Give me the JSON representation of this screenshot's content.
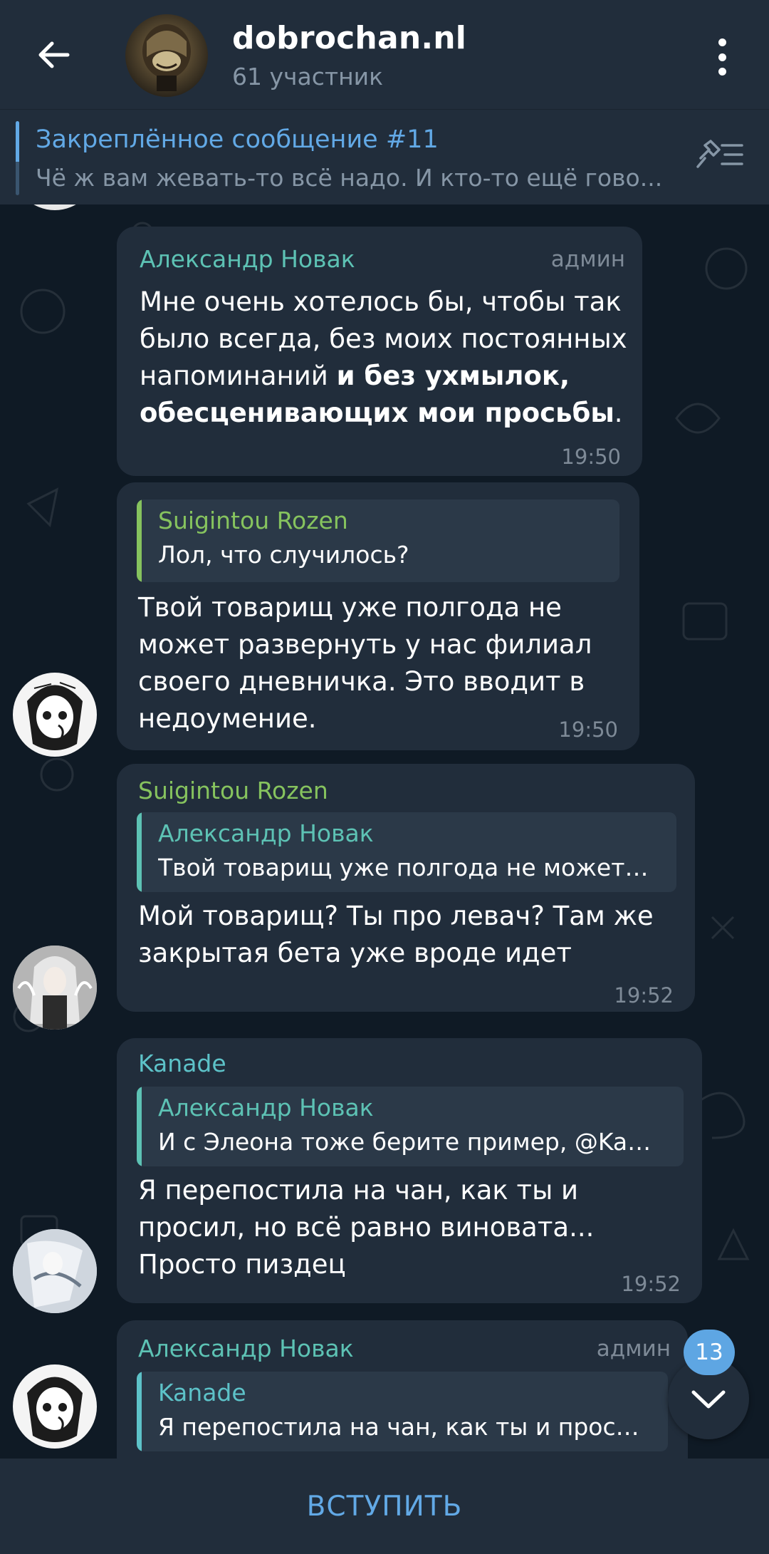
{
  "header": {
    "title": "dobrochan.nl",
    "subtitle": "61 участник"
  },
  "pinned": {
    "title": "Закреплённое сообщение #11",
    "text": "Чё ж вам жевать-то всё надо. И кто-то ещё гово..."
  },
  "messages": [
    {
      "sender": "Александр Новак",
      "sender_color": "#5dc2b4",
      "role": "админ",
      "text_plain": "Мне очень хотелось бы, чтобы так было всегда, без моих постоянных напоминаний",
      "text_bold": "и без ухмылок, обесценивающих мои просьбы",
      "text_end": ".",
      "time": "19:50"
    },
    {
      "reply_name": "Suigintou Rozen",
      "reply_color": "#86c35e",
      "reply_text": "Лол, что случилось?",
      "text": "Твой товарищ уже полгода не может развернуть у нас филиал своего дневничка. Это вводит в недоумение.",
      "time": "19:50"
    },
    {
      "sender": "Suigintou Rozen",
      "sender_color": "#86c35e",
      "reply_name": "Александр Новак",
      "reply_color": "#5dc2b4",
      "reply_text": "Твой товарищ уже полгода не может…",
      "text": "Мой товарищ? Ты про левач? Там же закрытая бета уже вроде идет",
      "time": "19:52"
    },
    {
      "sender": "Kanade",
      "sender_color": "#5dc2c8",
      "reply_name": "Александр Новак",
      "reply_color": "#5dc2b4",
      "reply_text": "И с Элеона тоже берите пример, @Ka…",
      "text": "Я перепостила на чан, как ты и просил, но всё равно виновата... Просто пиздец",
      "time": "19:52"
    },
    {
      "sender": "Александр Новак",
      "sender_color": "#5dc2b4",
      "role": "админ",
      "reply_name": "Kanade",
      "reply_color": "#5dc2c8",
      "reply_text": "Я перепостила на чан, как ты и прос…"
    }
  ],
  "unread_count": "13",
  "join_label": "ВСТУПИТЬ",
  "icons": [
    "arrow-left-icon",
    "more-vertical-icon",
    "pin-list-icon",
    "chevron-down-icon"
  ]
}
